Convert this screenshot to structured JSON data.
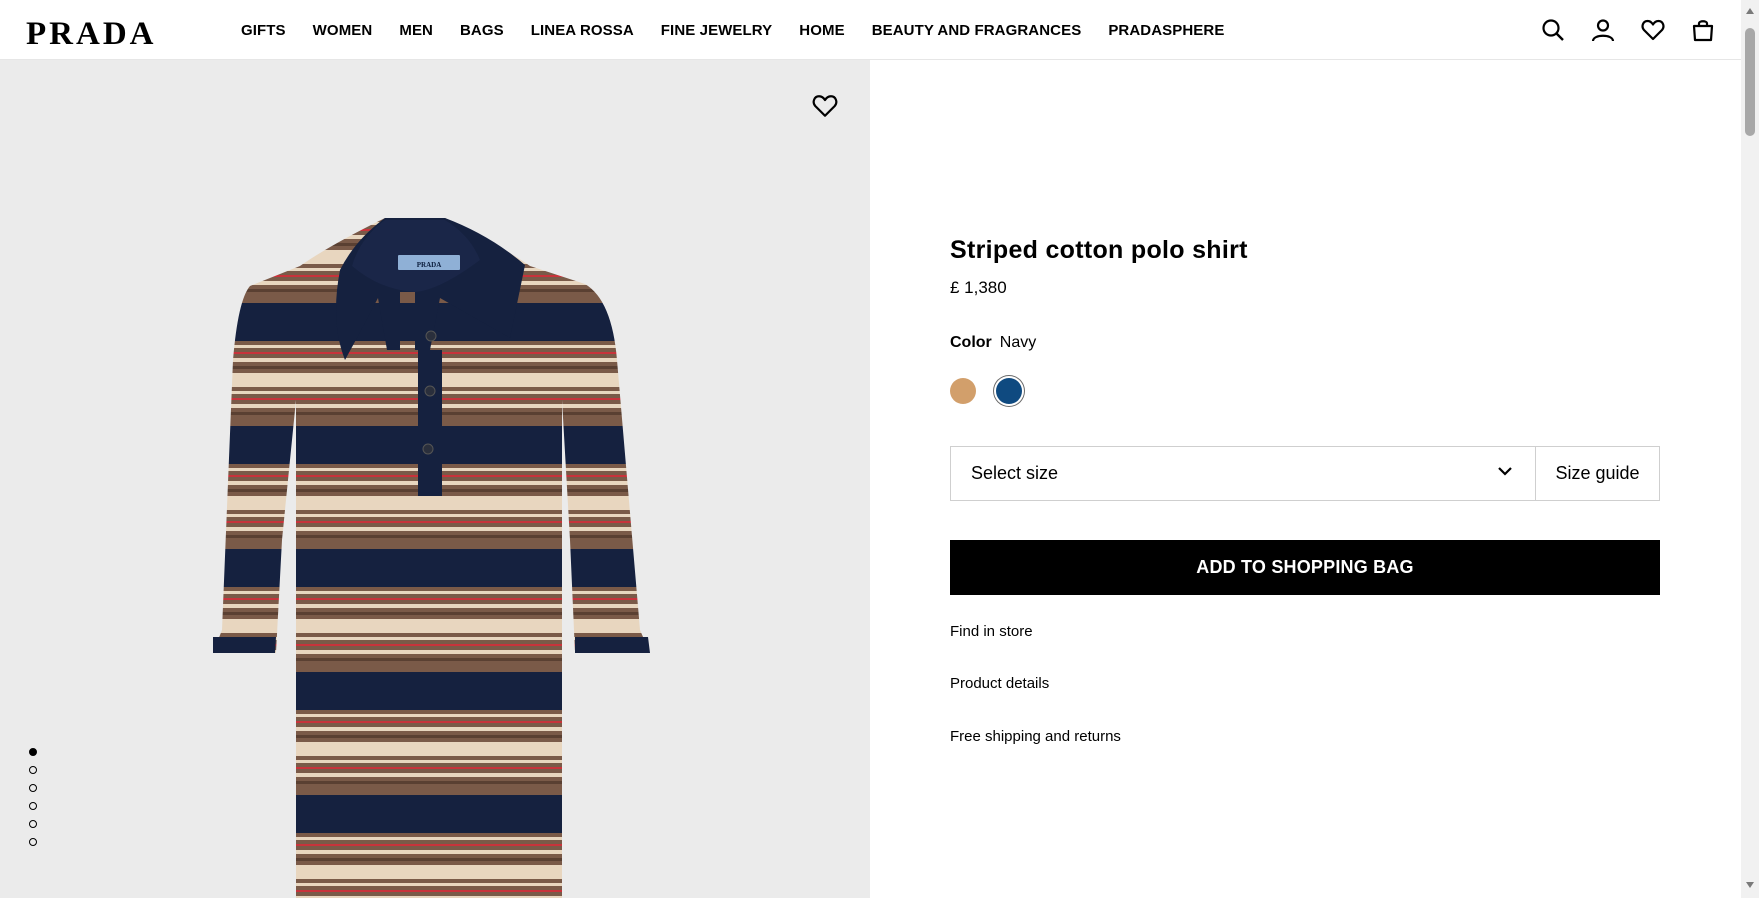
{
  "brand": {
    "logo": "PRADA"
  },
  "nav": {
    "items": [
      "GIFTS",
      "WOMEN",
      "MEN",
      "BAGS",
      "LINEA ROSSA",
      "FINE JEWELRY",
      "HOME",
      "BEAUTY AND FRAGRANCES",
      "PRADASPHERE"
    ]
  },
  "header_icons": [
    "search-icon",
    "account-icon",
    "wishlist-icon",
    "shopping-bag-icon"
  ],
  "gallery": {
    "wishlist_icon": "heart-icon",
    "image_count": 6,
    "active_index": 0
  },
  "product": {
    "title": "Striped cotton polo shirt",
    "price": "£ 1,380",
    "color_label": "Color",
    "color_value": "Navy",
    "swatches": [
      {
        "name": "camel",
        "hex": "#d29f6b",
        "selected": false
      },
      {
        "name": "navy",
        "hex": "#0f4a80",
        "selected": true
      }
    ],
    "size_placeholder": "Select size",
    "size_guide": "Size guide",
    "add_to_bag": "ADD TO SHOPPING BAG",
    "links": {
      "find_in_store": "Find in store",
      "product_details": "Product details",
      "shipping": "Free shipping and returns"
    }
  },
  "colors": {
    "navy_stripe": "#15213f",
    "beige_stripe": "#e8d6bf",
    "brown_stripe": "#7a5a48",
    "red_stripe": "#c8333b"
  }
}
